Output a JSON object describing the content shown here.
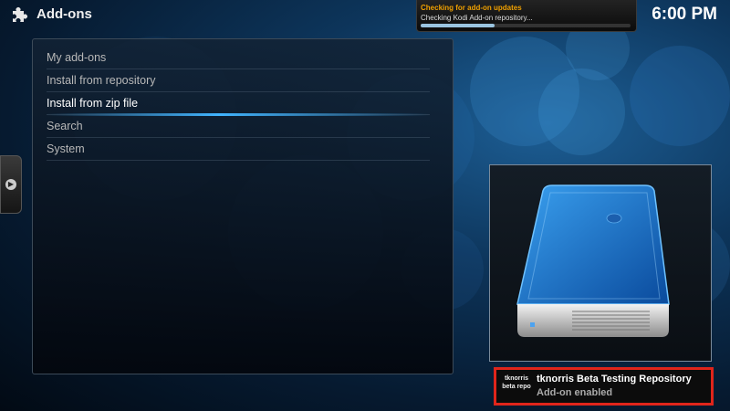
{
  "header": {
    "title": "Add-ons",
    "clock": "6:00 PM"
  },
  "notification": {
    "heading": "Checking for add-on updates",
    "message": "Checking Kodi Add-on repository...",
    "progress": 0.35
  },
  "menu": {
    "items": [
      {
        "label": "My add-ons"
      },
      {
        "label": "Install from repository"
      },
      {
        "label": "Install from zip file"
      },
      {
        "label": "Search"
      },
      {
        "label": "System"
      }
    ],
    "selected_index": 2
  },
  "toast": {
    "title": "tknorris Beta Testing Repository",
    "subtitle": "Add-on enabled",
    "logo_text": "tknorris beta repo",
    "highlight_color": "#e0251b"
  },
  "colors": {
    "accent": "#41b4ff"
  },
  "icons": {
    "header": "puzzle-piece-icon",
    "thumbnail": "hard-drive-icon",
    "sidebar": "arrow-right-icon"
  }
}
